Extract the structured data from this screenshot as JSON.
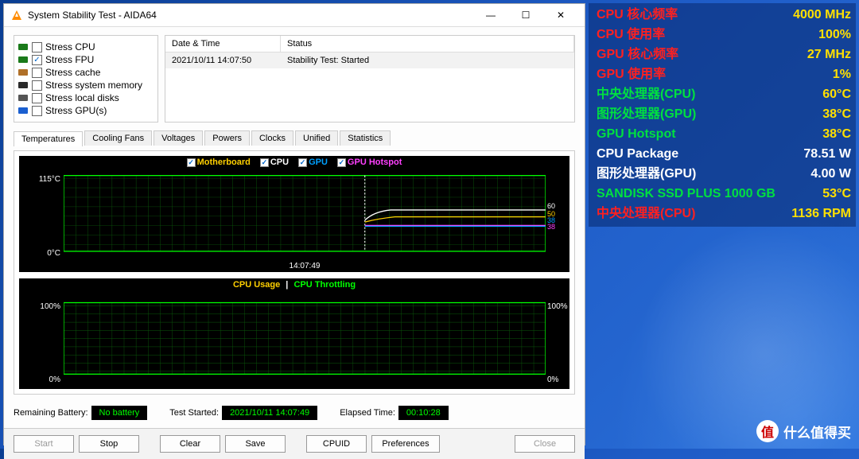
{
  "window": {
    "title": "System Stability Test - AIDA64",
    "minimize": "—",
    "maximize": "☐",
    "close": "✕"
  },
  "stress": [
    {
      "icon": "cpu",
      "color": "#1a7a1a",
      "label": "Stress CPU",
      "checked": false
    },
    {
      "icon": "fpu",
      "color": "#1a7a1a",
      "label": "Stress FPU",
      "checked": true
    },
    {
      "icon": "cache",
      "color": "#b07028",
      "label": "Stress cache",
      "checked": false
    },
    {
      "icon": "mem",
      "color": "#2a2a2a",
      "label": "Stress system memory",
      "checked": false
    },
    {
      "icon": "disk",
      "color": "#555",
      "label": "Stress local disks",
      "checked": false
    },
    {
      "icon": "gpu",
      "color": "#1a5fd0",
      "label": "Stress GPU(s)",
      "checked": false
    }
  ],
  "log": {
    "headers": [
      "Date & Time",
      "Status"
    ],
    "rows": [
      [
        "2021/10/11 14:07:50",
        "Stability Test: Started"
      ]
    ]
  },
  "tabs": [
    "Temperatures",
    "Cooling Fans",
    "Voltages",
    "Powers",
    "Clocks",
    "Unified",
    "Statistics"
  ],
  "active_tab": "Temperatures",
  "temp_chart": {
    "legend": [
      {
        "label": "Motherboard",
        "color": "#ffd000"
      },
      {
        "label": "CPU",
        "color": "#ffffff"
      },
      {
        "label": "GPU",
        "color": "#00a0ff"
      },
      {
        "label": "GPU Hotspot",
        "color": "#ff40ff"
      }
    ],
    "y_top": "115°C",
    "y_bot": "0°C",
    "right_labels": [
      {
        "v": "60",
        "c": "#ffffff"
      },
      {
        "v": "50",
        "c": "#ffd000"
      },
      {
        "v": "38",
        "c": "#00a0ff"
      },
      {
        "v": "38",
        "c": "#ff40ff"
      }
    ],
    "x_label": "14:07:49"
  },
  "cpu_chart": {
    "legend_l": "CPU Usage",
    "legend_sep": "|",
    "legend_r": "CPU Throttling",
    "y_top_l": "100%",
    "y_bot_l": "0%",
    "y_top_r": "100%",
    "y_bot_r": "0%"
  },
  "status": {
    "battery_label": "Remaining Battery:",
    "battery_value": "No battery",
    "started_label": "Test Started:",
    "started_value": "2021/10/11 14:07:49",
    "elapsed_label": "Elapsed Time:",
    "elapsed_value": "00:10:28"
  },
  "buttons": {
    "start": "Start",
    "stop": "Stop",
    "clear": "Clear",
    "save": "Save",
    "cpuid": "CPUID",
    "prefs": "Preferences",
    "close": "Close"
  },
  "overlay": [
    {
      "label": "CPU 核心频率",
      "value": "4000 MHz",
      "lc": "#ff2020",
      "vc": "#ffe000"
    },
    {
      "label": "CPU 使用率",
      "value": "100%",
      "lc": "#ff2020",
      "vc": "#ffe000"
    },
    {
      "label": "GPU 核心频率",
      "value": "27 MHz",
      "lc": "#ff2020",
      "vc": "#ffe000"
    },
    {
      "label": "GPU 使用率",
      "value": "1%",
      "lc": "#ff2020",
      "vc": "#ffe000"
    },
    {
      "label": "中央处理器(CPU)",
      "value": "60°C",
      "lc": "#00e040",
      "vc": "#ffe000"
    },
    {
      "label": "图形处理器(GPU)",
      "value": "38°C",
      "lc": "#00e040",
      "vc": "#ffe000"
    },
    {
      "label": "GPU Hotspot",
      "value": "38°C",
      "lc": "#00e040",
      "vc": "#ffe000"
    },
    {
      "label": "CPU Package",
      "value": "78.51 W",
      "lc": "#ffffff",
      "vc": "#ffffff"
    },
    {
      "label": "图形处理器(GPU)",
      "value": "4.00 W",
      "lc": "#ffffff",
      "vc": "#ffffff"
    },
    {
      "label": "SANDISK SSD PLUS 1000 GB",
      "value": "53°C",
      "lc": "#00e040",
      "vc": "#ffe000"
    },
    {
      "label": "中央处理器(CPU)",
      "value": "1136 RPM",
      "lc": "#ff2020",
      "vc": "#ffe000"
    }
  ],
  "watermark": "什么值得买",
  "wm_char": "值",
  "chart_data": {
    "type": "line",
    "title": "Temperatures",
    "ylabel": "°C",
    "ylim": [
      0,
      115
    ],
    "x_marker": "14:07:49",
    "series": [
      {
        "name": "Motherboard",
        "color": "#ffd000",
        "value_end": 50
      },
      {
        "name": "CPU",
        "color": "#ffffff",
        "value_end": 60
      },
      {
        "name": "GPU",
        "color": "#00a0ff",
        "value_end": 38
      },
      {
        "name": "GPU Hotspot",
        "color": "#ff40ff",
        "value_end": 38
      }
    ],
    "secondary": {
      "type": "line",
      "title": "CPU Usage / Throttling",
      "ylim": [
        0,
        100
      ],
      "series": [
        {
          "name": "CPU Usage",
          "value_end": 100
        },
        {
          "name": "CPU Throttling",
          "value_end": 0
        }
      ]
    }
  }
}
